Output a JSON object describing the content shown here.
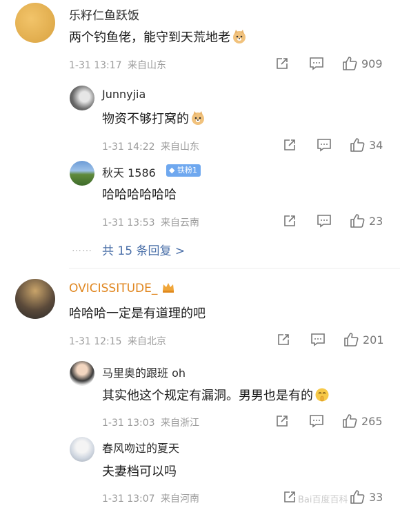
{
  "comments": [
    {
      "name": "乐籽仁鱼跃饭",
      "text": "两个钓鱼佬，能守到天荒地老",
      "time": "1-31 13:17",
      "location": "来自山东",
      "likes": "909",
      "replies": [
        {
          "name": "Junnyjia",
          "text": "物资不够打窝的",
          "time": "1-31 14:22",
          "location": "来自山东",
          "likes": "34"
        },
        {
          "name": "秋天 1586",
          "badge": "铁粉1",
          "text": "哈哈哈哈哈哈",
          "time": "1-31 13:53",
          "location": "来自云南",
          "likes": "23"
        }
      ],
      "more_replies": "共 15 条回复 >"
    },
    {
      "name": "OVICISSITUDE_",
      "text": "哈哈哈一定是有道理的吧",
      "time": "1-31 12:15",
      "location": "来自北京",
      "likes": "201",
      "replies": [
        {
          "name": "马里奥的跟班 oh",
          "text": "其实他这个规定有漏洞。男男也是有的",
          "time": "1-31 13:03",
          "location": "来自浙江",
          "likes": "265"
        },
        {
          "name": "春风吻过的夏天",
          "text": "夫妻档可以吗",
          "time": "1-31 13:07",
          "location": "来自河南",
          "likes": "33"
        }
      ]
    }
  ],
  "watermark": "Bai百度百科",
  "colors": {
    "name_orange": "#e0861f",
    "link_blue": "#4a6fa8",
    "meta_gray": "#9a9a9a",
    "badge_blue": "#6fa8ef"
  }
}
